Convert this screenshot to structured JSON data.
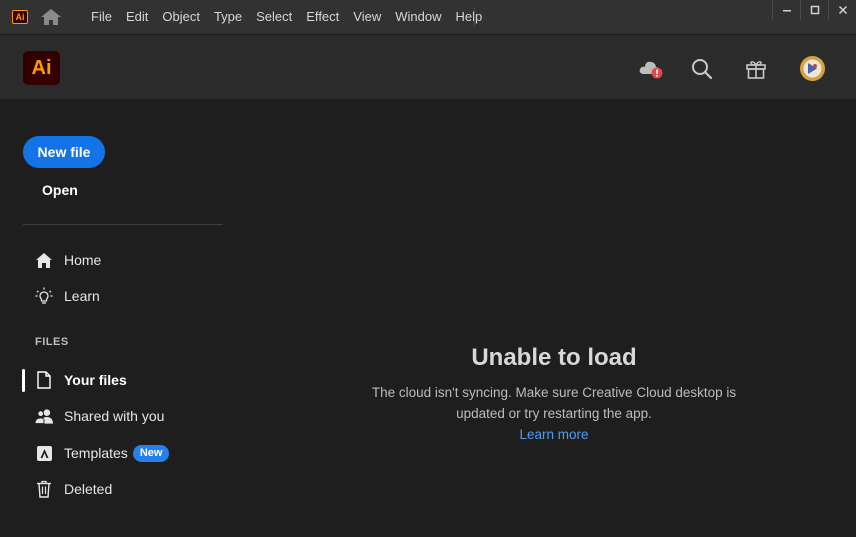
{
  "menubar": {
    "logo_text": "Ai",
    "items": [
      "File",
      "Edit",
      "Object",
      "Type",
      "Select",
      "Effect",
      "View",
      "Window",
      "Help"
    ]
  },
  "header": {
    "logo_text": "Ai",
    "icons": [
      "cloud-sync-error-icon",
      "search-icon",
      "gift-icon",
      "avatar"
    ]
  },
  "sidebar": {
    "new_file_label": "New file",
    "open_label": "Open",
    "nav": [
      {
        "label": "Home",
        "icon": "home-icon"
      },
      {
        "label": "Learn",
        "icon": "lightbulb-icon"
      }
    ],
    "files_section_label": "FILES",
    "files": [
      {
        "label": "Your files",
        "icon": "file-icon",
        "active": true
      },
      {
        "label": "Shared with you",
        "icon": "shared-users-icon"
      },
      {
        "label": "Templates",
        "icon": "templates-icon",
        "badge": "New"
      },
      {
        "label": "Deleted",
        "icon": "trash-icon"
      }
    ]
  },
  "main": {
    "title": "Unable to load",
    "body_line1": "The cloud isn't syncing. Make sure Creative Cloud desktop is",
    "body_line2": "updated or try restarting the app.",
    "link": "Learn more"
  },
  "colors": {
    "accent": "#1473e6",
    "link": "#4e9cf5",
    "brand_bg": "#330000",
    "brand_fg": "#ff9a00",
    "error": "#e34850"
  }
}
